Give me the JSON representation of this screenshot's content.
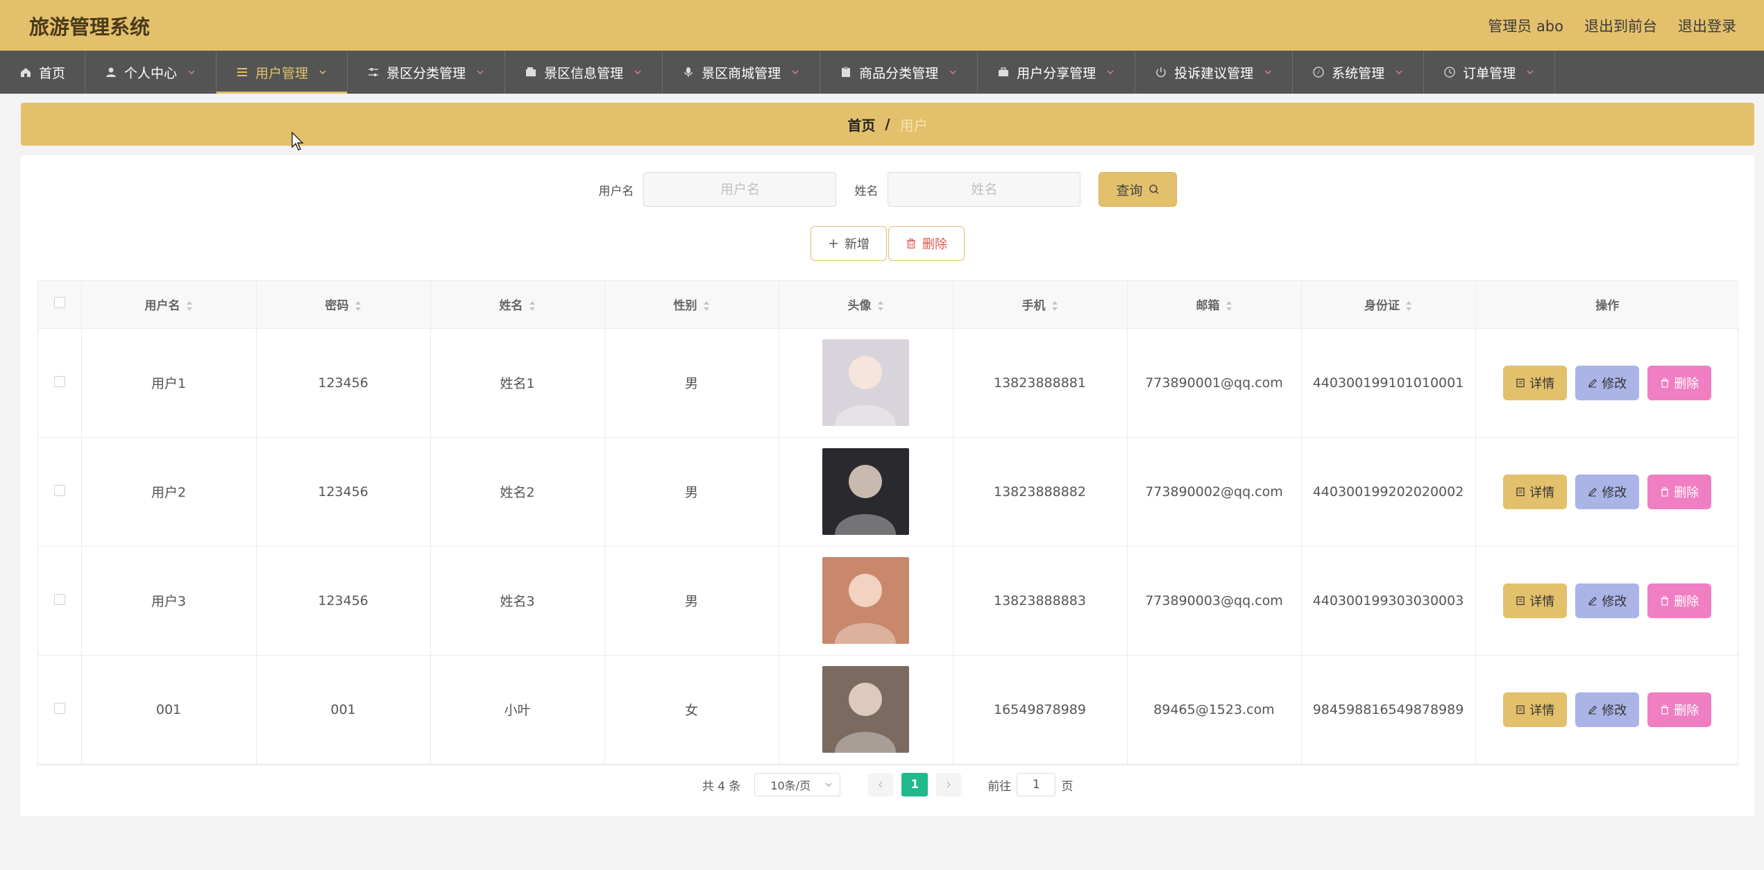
{
  "header": {
    "title": "旅游管理系统",
    "admin_label": "管理员 abo",
    "front_label": "退出到前台",
    "logout_label": "退出登录"
  },
  "nav": [
    {
      "label": "首页",
      "icon": "home-icon",
      "has_arrow": false
    },
    {
      "label": "个人中心",
      "icon": "user-icon",
      "has_arrow": true
    },
    {
      "label": "用户管理",
      "icon": "list-icon",
      "has_arrow": true,
      "active": true
    },
    {
      "label": "景区分类管理",
      "icon": "sliders-icon",
      "has_arrow": true
    },
    {
      "label": "景区信息管理",
      "icon": "wallet-icon",
      "has_arrow": true
    },
    {
      "label": "景区商城管理",
      "icon": "microphone-icon",
      "has_arrow": true
    },
    {
      "label": "商品分类管理",
      "icon": "clipboard-icon",
      "has_arrow": true
    },
    {
      "label": "用户分享管理",
      "icon": "briefcase-icon",
      "has_arrow": true
    },
    {
      "label": "投诉建议管理",
      "icon": "power-icon",
      "has_arrow": true
    },
    {
      "label": "系统管理",
      "icon": "compass-icon",
      "has_arrow": true
    },
    {
      "label": "订单管理",
      "icon": "clock-icon",
      "has_arrow": true
    }
  ],
  "breadcrumb": {
    "home": "首页",
    "sep": "/",
    "current": "用户"
  },
  "search": {
    "username_label": "用户名",
    "username_placeholder": "用户名",
    "name_label": "姓名",
    "name_placeholder": "姓名",
    "query_label": "查询"
  },
  "actions": {
    "add_label": "新增",
    "delete_label": "删除"
  },
  "table": {
    "columns": [
      "用户名",
      "密码",
      "姓名",
      "性别",
      "头像",
      "手机",
      "邮箱",
      "身份证",
      "操作"
    ],
    "rows": [
      {
        "username": "用户1",
        "password": "123456",
        "name": "姓名1",
        "gender": "男",
        "avatar_color": "#d9d4dc",
        "phone": "13823888881",
        "email": "773890001@qq.com",
        "idcard": "440300199101010001"
      },
      {
        "username": "用户2",
        "password": "123456",
        "name": "姓名2",
        "gender": "男",
        "avatar_color": "#2a2a2e",
        "phone": "13823888882",
        "email": "773890002@qq.com",
        "idcard": "440300199202020002"
      },
      {
        "username": "用户3",
        "password": "123456",
        "name": "姓名3",
        "gender": "男",
        "avatar_color": "#c9876b",
        "phone": "13823888883",
        "email": "773890003@qq.com",
        "idcard": "440300199303030003"
      },
      {
        "username": "001",
        "password": "001",
        "name": "小叶",
        "gender": "女",
        "avatar_color": "#7a6a60",
        "phone": "16549878989",
        "email": "89465@1523.com",
        "idcard": "984598816549878989"
      }
    ],
    "op_detail": "详情",
    "op_edit": "修改",
    "op_delete": "删除"
  },
  "pager": {
    "total": "共 4 条",
    "page_size": "10条/页",
    "current_page": "1",
    "goto_prefix": "前往",
    "goto_value": "1",
    "goto_suffix": "页"
  },
  "colors": {
    "accent": "#e3c06b",
    "nav_bg": "#545454",
    "pager_active": "#1fb98b",
    "edit_btn": "#aab4e6",
    "delete_btn": "#f07ec2"
  }
}
